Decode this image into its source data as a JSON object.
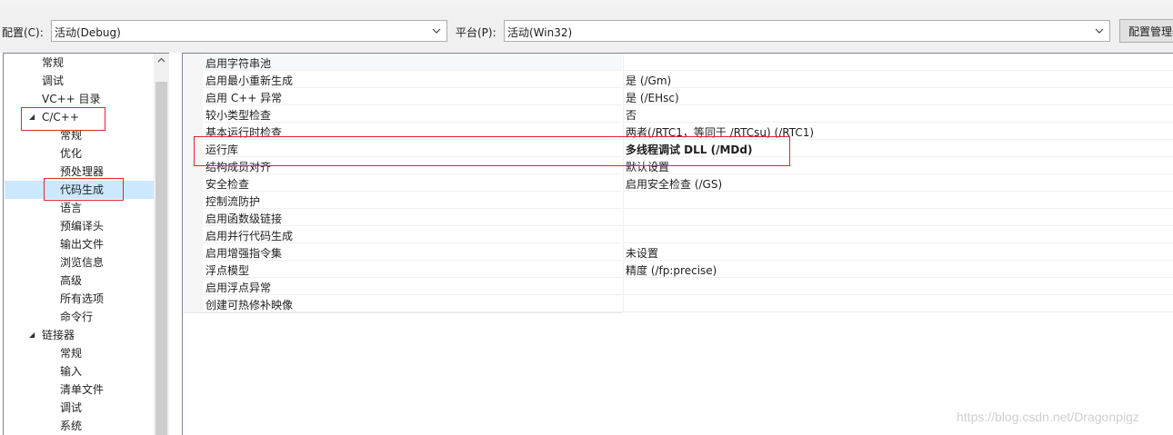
{
  "toolbar": {
    "config_label": "配置(C):",
    "config_value": "活动(Debug)",
    "platform_label": "平台(P):",
    "platform_value": "活动(Win32)",
    "config_manager_label": "配置管理器"
  },
  "tree": {
    "items": [
      {
        "label": "常规"
      },
      {
        "label": "调试"
      },
      {
        "label": "VC++ 目录"
      },
      {
        "label": "C/C++"
      },
      {
        "label": "常规"
      },
      {
        "label": "优化"
      },
      {
        "label": "预处理器"
      },
      {
        "label": "代码生成"
      },
      {
        "label": "语言"
      },
      {
        "label": "预编译头"
      },
      {
        "label": "输出文件"
      },
      {
        "label": "浏览信息"
      },
      {
        "label": "高级"
      },
      {
        "label": "所有选项"
      },
      {
        "label": "命令行"
      },
      {
        "label": "链接器"
      },
      {
        "label": "常规"
      },
      {
        "label": "输入"
      },
      {
        "label": "清单文件"
      },
      {
        "label": "调试"
      },
      {
        "label": "系统"
      }
    ],
    "toggle_glyph": "◢"
  },
  "properties": [
    {
      "name": "启用字符串池",
      "value": ""
    },
    {
      "name": "启用最小重新生成",
      "value": "是 (/Gm)"
    },
    {
      "name": "启用 C++ 异常",
      "value": "是 (/EHsc)"
    },
    {
      "name": "较小类型检查",
      "value": "否"
    },
    {
      "name": "基本运行时检查",
      "value": "两者(/RTC1，等同于 /RTCsu) (/RTC1)"
    },
    {
      "name": "运行库",
      "value": "多线程调试 DLL (/MDd)"
    },
    {
      "name": "结构成员对齐",
      "value": "默认设置"
    },
    {
      "name": "安全检查",
      "value": "启用安全检查 (/GS)"
    },
    {
      "name": "控制流防护",
      "value": ""
    },
    {
      "name": "启用函数级链接",
      "value": ""
    },
    {
      "name": "启用并行代码生成",
      "value": ""
    },
    {
      "name": "启用增强指令集",
      "value": "未设置"
    },
    {
      "name": "浮点模型",
      "value": "精度 (/fp:precise)"
    },
    {
      "name": "启用浮点异常",
      "value": ""
    },
    {
      "name": "创建可热修补映像",
      "value": ""
    }
  ],
  "watermark": "https://blog.csdn.net/Dragonpigz",
  "colors": {
    "highlight": "#e8222f",
    "selection": "#cce8ff"
  }
}
